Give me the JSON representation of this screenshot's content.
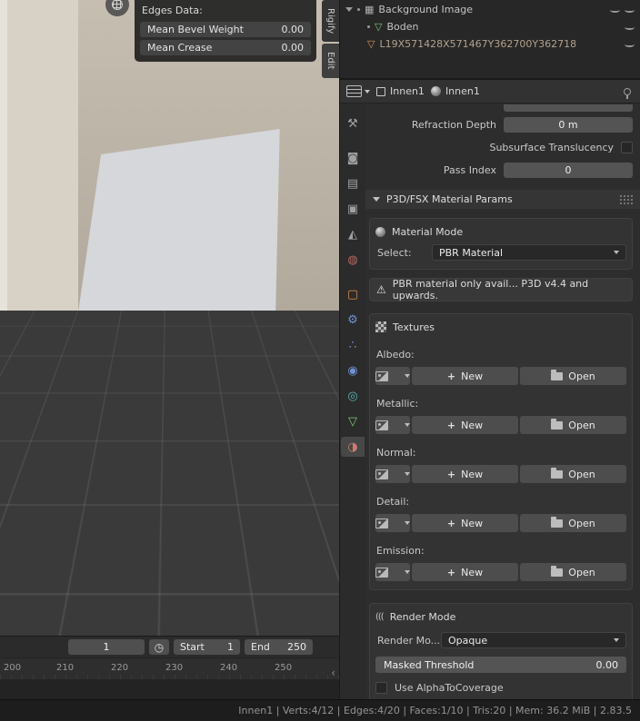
{
  "viewport": {
    "edges_data_panel": {
      "title": "Edges Data:",
      "rows": [
        {
          "label": "Mean Bevel Weight",
          "value": "0.00"
        },
        {
          "label": "Mean Crease",
          "value": "0.00"
        }
      ]
    },
    "sidebar_tabs": [
      {
        "label": "Rigify"
      },
      {
        "label": "Edit"
      }
    ]
  },
  "outliner": {
    "items": [
      {
        "label": "Background Image",
        "icon": "image-icon",
        "glyph": "▦"
      },
      {
        "label": "Boden",
        "icon": "mesh-data-icon",
        "glyph": "▽"
      },
      {
        "label": "L19X571428X571467Y362700Y362718",
        "icon": "mesh-data-icon",
        "glyph": "▽"
      }
    ]
  },
  "properties": {
    "header": {
      "object_name": "Innen1",
      "data_name": "Innen1"
    },
    "rows": {
      "refraction_depth_label": "Refraction Depth",
      "refraction_depth_value": "0 m",
      "subsurface_label": "Subsurface Translucency",
      "pass_index_label": "Pass Index",
      "pass_index_value": "0"
    },
    "p3d_panel": {
      "title": "P3D/FSX Material Params",
      "material_mode_title": "Material Mode",
      "select_label": "Select:",
      "select_value": "PBR Material",
      "warning_text": "PBR material only avail... P3D v4.4 and upwards.",
      "textures_title": "Textures",
      "texture_slots": [
        {
          "label": "Albedo:",
          "new_label": "New",
          "open_label": "Open"
        },
        {
          "label": "Metallic:",
          "new_label": "New",
          "open_label": "Open"
        },
        {
          "label": "Normal:",
          "new_label": "New",
          "open_label": "Open"
        },
        {
          "label": "Detail:",
          "new_label": "New",
          "open_label": "Open"
        },
        {
          "label": "Emission:",
          "new_label": "New",
          "open_label": "Open"
        }
      ],
      "render_mode_title": "Render Mode",
      "render_mode_label": "Render Mo...",
      "render_mode_value": "Opaque",
      "masked_threshold_label": "Masked Threshold",
      "masked_threshold_value": "0.00",
      "alpha_to_coverage_label": "Use AlphaToCoverage"
    },
    "tabs": {
      "active": "material",
      "items": [
        {
          "name": "tool",
          "glyph": "⚒"
        },
        {
          "name": "render",
          "glyph": "◙"
        },
        {
          "name": "output",
          "glyph": "▤"
        },
        {
          "name": "view-layer",
          "glyph": "▣"
        },
        {
          "name": "scene",
          "glyph": "◭"
        },
        {
          "name": "world",
          "glyph": "◍"
        },
        {
          "name": "object",
          "glyph": "▢"
        },
        {
          "name": "modifiers",
          "glyph": "⚙"
        },
        {
          "name": "particles",
          "glyph": "∴"
        },
        {
          "name": "physics",
          "glyph": "◉"
        },
        {
          "name": "constraints",
          "glyph": "◎"
        },
        {
          "name": "object-data",
          "glyph": "▽"
        },
        {
          "name": "material",
          "glyph": "◑"
        }
      ]
    }
  },
  "timeline": {
    "current_frame": "1",
    "clock_glyph": "◷",
    "start_label": "Start",
    "start_value": "1",
    "end_label": "End",
    "end_value": "250",
    "ticks": [
      "200",
      "210",
      "220",
      "230",
      "240",
      "250"
    ],
    "collapse_glyph": "‹"
  },
  "status_bar": {
    "text": "Innen1 | Verts:4/12 | Edges:4/20 | Faces:1/10 | Tris:20 | Mem: 36.2 MiB | 2.83.5"
  },
  "colors": {
    "selected_face": "#d6d7db",
    "object_orange": "#dd8f45",
    "mesh_green": "#7ac57a",
    "field_gray": "#545454"
  }
}
